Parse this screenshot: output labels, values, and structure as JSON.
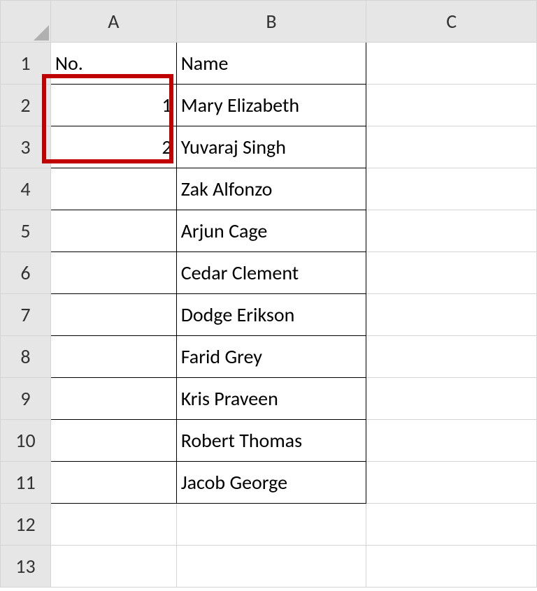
{
  "columns": {
    "A": "A",
    "B": "B",
    "C": "C"
  },
  "rowLabels": [
    "1",
    "2",
    "3",
    "4",
    "5",
    "6",
    "7",
    "8",
    "9",
    "10",
    "11",
    "12",
    "13"
  ],
  "headers": {
    "A": "No.",
    "B": "Name"
  },
  "rows": [
    {
      "no": "1",
      "name": "Mary Elizabeth"
    },
    {
      "no": "2",
      "name": "Yuvaraj Singh"
    },
    {
      "no": "",
      "name": "Zak Alfonzo"
    },
    {
      "no": "",
      "name": "Arjun Cage"
    },
    {
      "no": "",
      "name": "Cedar Clement"
    },
    {
      "no": "",
      "name": "Dodge Erikson"
    },
    {
      "no": "",
      "name": "Farid Grey"
    },
    {
      "no": "",
      "name": "Kris Praveen"
    },
    {
      "no": "",
      "name": "Robert Thomas"
    },
    {
      "no": "",
      "name": "Jacob George"
    }
  ],
  "chart_data": {
    "type": "table",
    "columns": [
      "No.",
      "Name"
    ],
    "data": [
      [
        1,
        "Mary Elizabeth"
      ],
      [
        2,
        "Yuvaraj Singh"
      ],
      [
        null,
        "Zak Alfonzo"
      ],
      [
        null,
        "Arjun Cage"
      ],
      [
        null,
        "Cedar Clement"
      ],
      [
        null,
        "Dodge Erikson"
      ],
      [
        null,
        "Farid Grey"
      ],
      [
        null,
        "Kris Praveen"
      ],
      [
        null,
        "Robert Thomas"
      ],
      [
        null,
        "Jacob George"
      ]
    ]
  }
}
